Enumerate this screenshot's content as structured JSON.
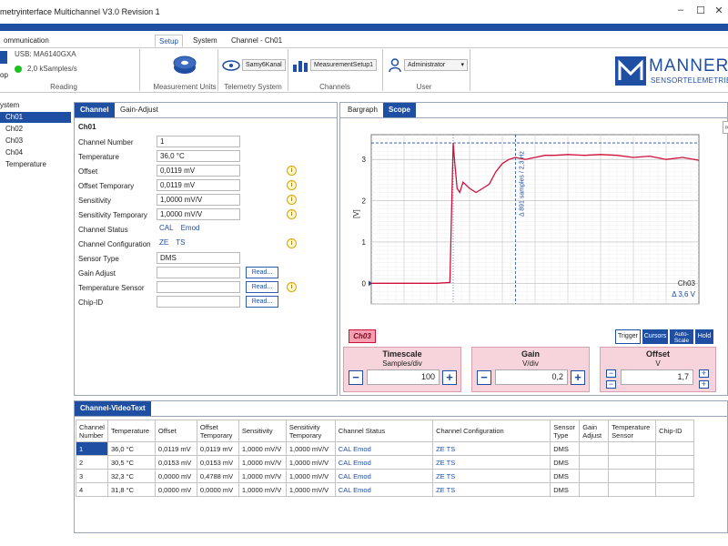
{
  "window": {
    "title": "metryinterface Multichannel V3.0 Revision 1",
    "controls": [
      "–",
      "☐",
      "✕"
    ]
  },
  "ribbon": {
    "tabs": [
      {
        "label": "ommunication",
        "active": false
      },
      {
        "label": "Setup",
        "active": true
      },
      {
        "label": "System",
        "active": false
      },
      {
        "label": "Channel - Ch01",
        "active": false
      }
    ],
    "reading": {
      "stop_fragment": "op",
      "usb": "USB: MA6140GXA",
      "rate": "2,0 kSamples/s",
      "group_label": "Reading"
    },
    "measurement_units": {
      "label": "Measurement Units"
    },
    "telemetry": {
      "combo": "Samy6Kanal",
      "group_label": "Telemetry System"
    },
    "channels": {
      "combo": "MeasurementSetup1",
      "group_label": "Channels"
    },
    "user": {
      "combo": "Administrator",
      "group_label": "User"
    },
    "logo": {
      "text": "MANNER",
      "sub": "SENSORTELEMETRIE"
    }
  },
  "tree": {
    "root": "ystem",
    "items": [
      "Ch01",
      "Ch02",
      "Ch03",
      "Ch04",
      "Temperature"
    ],
    "selected": 0
  },
  "channel_panel": {
    "tabs": [
      "Channel",
      "Gain-Adjust"
    ],
    "heading": "Ch01",
    "fields": [
      {
        "label": "Channel Number",
        "value": "1",
        "info": false
      },
      {
        "label": "Temperature",
        "value": "36,0 °C",
        "info": false
      },
      {
        "label": "Offset",
        "value": "0,0119 mV",
        "info": true
      },
      {
        "label": "Offset Temporary",
        "value": "0,0119 mV",
        "info": true
      },
      {
        "label": "Sensitivity",
        "value": "1,0000 mV/V",
        "info": true
      },
      {
        "label": "Sensitivity Temporary",
        "value": "1,0000 mV/V",
        "info": true
      },
      {
        "label": "Channel Status",
        "tags": [
          "CAL",
          "Emod"
        ],
        "info": false
      },
      {
        "label": "Channel Configuration",
        "tags": [
          "ZE",
          "TS"
        ],
        "info": true
      },
      {
        "label": "Sensor Type",
        "value": "DMS",
        "info": false
      },
      {
        "label": "Gain Adjust",
        "value": "",
        "read": "Read...",
        "info": false
      },
      {
        "label": "Temperature Sensor",
        "value": "",
        "read": "Read...",
        "info": true
      },
      {
        "label": "Chip-ID",
        "value": "",
        "read": "Read...",
        "info": false
      }
    ]
  },
  "scope": {
    "tabs": [
      "Bargraph",
      "Scope"
    ],
    "channel_badge": "Ch03",
    "modes": [
      "Trigger",
      "Cursors",
      "Auto-Scale",
      "Hold"
    ],
    "timescale": {
      "title": "Timescale",
      "unit": "Samples/div",
      "value": "100"
    },
    "gain": {
      "title": "Gain",
      "unit": "V/div",
      "value": "0,2"
    },
    "offset": {
      "title": "Offset",
      "unit": "V",
      "value": "1,7"
    },
    "collapse_icon": "»"
  },
  "chart_data": {
    "type": "line",
    "ylabel": "[V]",
    "yticks": [
      "0",
      "1",
      "2",
      "3"
    ],
    "ylim": [
      -0.5,
      3.6
    ],
    "xlim": [
      0,
      1000
    ],
    "grid": true,
    "series": [
      {
        "name": "Ch03",
        "color": "#d0103a",
        "x": [
          0,
          150,
          200,
          240,
          250,
          255,
          262,
          270,
          280,
          300,
          320,
          340,
          360,
          380,
          400,
          420,
          440,
          470,
          500,
          530,
          560,
          600,
          650,
          700,
          750,
          800,
          850,
          900,
          950,
          1000
        ],
        "y": [
          0,
          0,
          0,
          0.02,
          3.4,
          2.9,
          2.3,
          2.2,
          2.45,
          2.3,
          2.2,
          2.3,
          2.4,
          2.7,
          2.9,
          3.0,
          3.05,
          3.0,
          3.05,
          3.1,
          3.1,
          3.12,
          3.1,
          3.12,
          3.1,
          3.05,
          3.08,
          3.0,
          3.05,
          2.98
        ]
      }
    ],
    "annotations": {
      "cursor_label": "Δ 891 samples / 2,3 Hz",
      "channel_label": "Ch03",
      "delta_label": "Δ 3,6 V",
      "cursor_x": 440,
      "cursor_y": 3.4
    }
  },
  "videotext": {
    "title": "Channel-VideoText",
    "columns": [
      "Channel Number",
      "Temperature",
      "Offset",
      "Offset Temporary",
      "Sensitivity",
      "Sensitivity Temporary",
      "Channel Status",
      "Channel Configuration",
      "Sensor Type",
      "Gain Adjust",
      "Temperature Sensor",
      "Chip-ID"
    ],
    "rows": [
      [
        "1",
        "36,0 °C",
        "0,0119 mV",
        "0,0119 mV",
        "1,0000 mV/V",
        "1,0000 mV/V",
        "CAL  Emod",
        "ZE  TS",
        "DMS",
        "",
        "",
        ""
      ],
      [
        "2",
        "30,5 °C",
        "0,0153 mV",
        "0,0153 mV",
        "1,0000 mV/V",
        "1,0000 mV/V",
        "CAL  Emod",
        "ZE  TS",
        "DMS",
        "",
        "",
        ""
      ],
      [
        "3",
        "32,3 °C",
        "0,0000 mV",
        "0,4788 mV",
        "1,0000 mV/V",
        "1,0000 mV/V",
        "CAL  Emod",
        "ZE  TS",
        "DMS",
        "",
        "",
        ""
      ],
      [
        "4",
        "31,8 °C",
        "0,0000 mV",
        "0,0000 mV",
        "1,0000 mV/V",
        "1,0000 mV/V",
        "CAL  Emod",
        "ZE  TS",
        "DMS",
        "",
        "",
        ""
      ]
    ]
  }
}
